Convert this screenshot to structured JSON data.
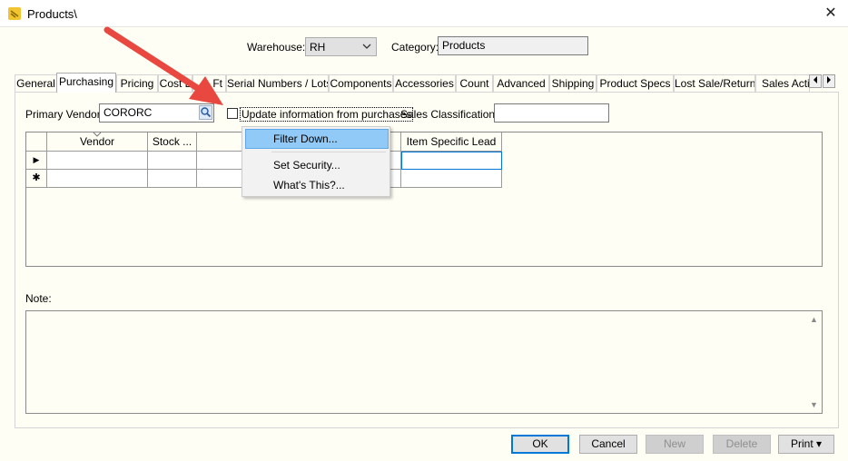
{
  "window": {
    "title": "Products\\",
    "close_glyph": "✕"
  },
  "header": {
    "warehouse_label": "Warehouse:",
    "warehouse_value": "RH",
    "category_label": "Category:",
    "category_value": "Products"
  },
  "tabs": [
    {
      "label": "General"
    },
    {
      "label": "Purchasing",
      "active": true
    },
    {
      "label": "Pricing"
    },
    {
      "label": "Cost L"
    },
    {
      "label": "Ft"
    },
    {
      "label": "Serial Numbers / Lots"
    },
    {
      "label": "Components"
    },
    {
      "label": "Accessories"
    },
    {
      "label": "Count"
    },
    {
      "label": "Advanced"
    },
    {
      "label": "Shipping"
    },
    {
      "label": "Product Specs"
    },
    {
      "label": "Lost Sale/Return"
    },
    {
      "label": "Sales Activ"
    }
  ],
  "purchasing": {
    "primary_vendor_label": "Primary Vendor:",
    "primary_vendor_value": "CORORC",
    "update_checkbox_label": "Update information from purchases",
    "update_checked": false,
    "sales_classification_label": "Sales Classification:",
    "sales_classification_value": ""
  },
  "grid": {
    "columns": [
      "Vendor",
      "Stock ...",
      "",
      "Item Specific Lead"
    ],
    "row_markers": [
      "▶",
      "✱"
    ]
  },
  "note": {
    "label": "Note:",
    "value": ""
  },
  "context_menu": {
    "items": [
      {
        "label": "Filter Down...",
        "highlighted": true
      },
      {
        "label": "Set Security..."
      },
      {
        "label": "What's This?..."
      }
    ]
  },
  "buttons": {
    "ok": "OK",
    "cancel": "Cancel",
    "new": "New",
    "delete": "Delete",
    "print": "Print ▾"
  },
  "colors": {
    "arrow": "#e8483f",
    "accent": "#0078d7",
    "menu_highlight": "#91c9f7"
  }
}
